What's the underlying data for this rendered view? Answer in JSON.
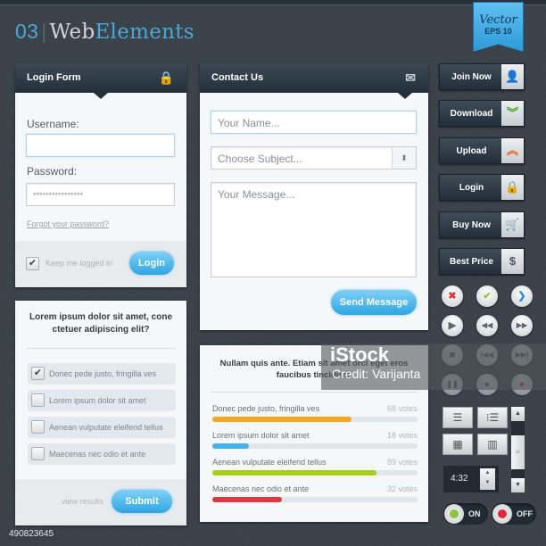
{
  "header": {
    "number": "03",
    "title_part1": "Web",
    "title_part2": "Elements"
  },
  "ribbon": {
    "line1": "Vector",
    "line2": "EPS 10"
  },
  "login_form": {
    "title": "Login Form",
    "header_icon": "lock-icon",
    "username_label": "Username:",
    "username_value": "",
    "password_label": "Password:",
    "password_value": "****************",
    "forgot_link": "Forgot your password?",
    "keep_logged_in": "Keep me logged in",
    "keep_logged_in_checked": true,
    "login_button": "Login"
  },
  "contact_form": {
    "title": "Contact Us",
    "header_icon": "envelope-icon",
    "name_placeholder": "Your Name...",
    "subject_placeholder": "Choose Subject...",
    "message_placeholder": "Your Message...",
    "send_button": "Send Message"
  },
  "side_buttons": [
    {
      "label": "Join Now",
      "icon": "user-icon",
      "glyph": "👤",
      "color": "#2a82c8"
    },
    {
      "label": "Download",
      "icon": "double-chevron-down-icon",
      "glyph": "︾",
      "color": "#4caa2c"
    },
    {
      "label": "Upload",
      "icon": "double-chevron-up-icon",
      "glyph": "︽",
      "color": "#e8642a"
    },
    {
      "label": "Login",
      "icon": "lock-icon",
      "glyph": "🔒",
      "color": "#4d565e"
    },
    {
      "label": "Buy Now",
      "icon": "cart-icon",
      "glyph": "🛒",
      "color": "#4d565e"
    },
    {
      "label": "Best Price",
      "icon": "dollar-icon",
      "glyph": "$",
      "color": "#4d565e"
    }
  ],
  "round_buttons": [
    {
      "icon": "close-icon",
      "glyph": "✖",
      "color": "#d83a3a"
    },
    {
      "icon": "check-icon",
      "glyph": "✔",
      "color": "#8cc63f"
    },
    {
      "icon": "chevron-right-icon",
      "glyph": "❯",
      "color": "#2a8ad8"
    },
    {
      "icon": "play-icon",
      "glyph": "▶",
      "color": "#5d6873"
    },
    {
      "icon": "rewind-icon",
      "glyph": "◀◀",
      "color": "#5d6873"
    },
    {
      "icon": "fast-forward-icon",
      "glyph": "▶▶",
      "color": "#5d6873"
    },
    {
      "icon": "stop-icon",
      "glyph": "■",
      "color": "#5d6873"
    },
    {
      "icon": "skip-back-icon",
      "glyph": "|◀◀",
      "color": "#5d6873"
    },
    {
      "icon": "skip-forward-icon",
      "glyph": "▶▶|",
      "color": "#5d6873"
    },
    {
      "icon": "pause-icon",
      "glyph": "❚❚",
      "color": "#5d6873"
    },
    {
      "icon": "record-icon",
      "glyph": "●",
      "color": "#5d6873"
    },
    {
      "icon": "record-red-icon",
      "glyph": "●",
      "color": "#d83a3a"
    }
  ],
  "view_buttons": [
    {
      "icon": "list-view-icon",
      "glyph": "☰"
    },
    {
      "icon": "detail-list-icon",
      "glyph": "⁝☰"
    },
    {
      "icon": "grid-view-icon",
      "glyph": "▦"
    },
    {
      "icon": "filmstrip-icon",
      "glyph": "▥"
    }
  ],
  "time_stepper": {
    "value": "4:32"
  },
  "toggles": [
    {
      "label": "ON",
      "dot_color": "#8cc63f"
    },
    {
      "label": "OFF",
      "dot_color": "#e02a36"
    }
  ],
  "poll": {
    "question": "Lorem ipsum dolor sit amet, cone ctetuer adipiscing elit?",
    "options": [
      {
        "label": "Donec pede justo, fringilla ves",
        "checked": true
      },
      {
        "label": "Lorem ipsum dolor sit amet",
        "checked": false
      },
      {
        "label": "Aenean vulputate eleifend tellus",
        "checked": false
      },
      {
        "label": "Maecenas nec odio et ante",
        "checked": false
      }
    ],
    "view_results": "view results",
    "submit": "Submit"
  },
  "results": {
    "question": "Nullam quis ante. Etiam sit amet orci eget eros faucibus tincidunt.",
    "items": [
      {
        "label": "Donec pede justo, fringilla ves",
        "votes": "68 votes",
        "percent": 68,
        "color": "#f5a623"
      },
      {
        "label": "Lorem ipsum dolor sit amet",
        "votes": "18 votes",
        "percent": 18,
        "color": "#3fb4ee"
      },
      {
        "label": "Aenean vulputate eleifend tellus",
        "votes": "89 votes",
        "percent": 80,
        "color": "#a8cf1a"
      },
      {
        "label": "Maecenas nec odio et ante",
        "votes": "32 votes",
        "percent": 34,
        "color": "#e2363e"
      }
    ]
  },
  "watermark": {
    "brand": "iStock",
    "credit": "Credit: Varijanta"
  },
  "image_id": "490823645"
}
